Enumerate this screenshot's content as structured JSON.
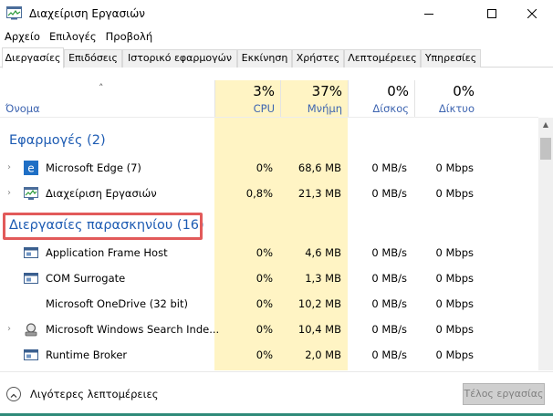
{
  "window": {
    "title": "Διαχείριση Εργασιών"
  },
  "menu": [
    "Αρχείο",
    "Επιλογές",
    "Προβολή"
  ],
  "tabs": [
    {
      "label": "Διεργασίες",
      "active": true
    },
    {
      "label": "Επιδόσεις",
      "active": false
    },
    {
      "label": "Ιστορικό εφαρμογών",
      "active": false
    },
    {
      "label": "Εκκίνηση",
      "active": false
    },
    {
      "label": "Χρήστες",
      "active": false
    },
    {
      "label": "Λεπτομέρειες",
      "active": false
    },
    {
      "label": "Υπηρεσίες",
      "active": false
    }
  ],
  "columns": {
    "name": "Όνομα",
    "cpu": {
      "percent": "3%",
      "label": "CPU"
    },
    "memory": {
      "percent": "37%",
      "label": "Μνήμη"
    },
    "disk": {
      "percent": "0%",
      "label": "Δίσκος"
    },
    "network": {
      "percent": "0%",
      "label": "Δίκτυο"
    }
  },
  "groups": {
    "apps": {
      "title": "Εφαρμογές (2)",
      "rows": [
        {
          "name": "Microsoft Edge (7)",
          "icon": "edge-icon",
          "expandable": true,
          "cpu": "0%",
          "memory": "68,6 MB",
          "disk": "0 MB/s",
          "network": "0 Mbps"
        },
        {
          "name": "Διαχείριση Εργασιών",
          "icon": "task-manager-icon",
          "expandable": true,
          "cpu": "0,8%",
          "memory": "21,3 MB",
          "disk": "0 MB/s",
          "network": "0 Mbps"
        }
      ]
    },
    "background": {
      "title": "Διεργασίες παρασκηνίου (16)",
      "rows": [
        {
          "name": "Application Frame Host",
          "icon": "app-window-icon",
          "expandable": false,
          "cpu": "0%",
          "memory": "4,6 MB",
          "disk": "0 MB/s",
          "network": "0 Mbps"
        },
        {
          "name": "COM Surrogate",
          "icon": "app-window-icon",
          "expandable": false,
          "cpu": "0%",
          "memory": "1,3 MB",
          "disk": "0 MB/s",
          "network": "0 Mbps"
        },
        {
          "name": "Microsoft OneDrive (32 bit)",
          "icon": "",
          "expandable": false,
          "cpu": "0%",
          "memory": "10,2 MB",
          "disk": "0 MB/s",
          "network": "0 Mbps"
        },
        {
          "name": "Microsoft Windows Search Inde...",
          "icon": "search-indexer-icon",
          "expandable": true,
          "cpu": "0%",
          "memory": "10,4 MB",
          "disk": "0 MB/s",
          "network": "0 Mbps"
        },
        {
          "name": "Runtime Broker",
          "icon": "app-window-icon",
          "expandable": false,
          "cpu": "0%",
          "memory": "2,0 MB",
          "disk": "0 MB/s",
          "network": "0 Mbps"
        }
      ]
    }
  },
  "footer": {
    "less_details": "Λιγότερες λεπτομέρειες",
    "end_task": "Τέλος εργασίας"
  },
  "colors": {
    "accent_blue": "#1e5cb3",
    "heat_yellow": "#fff4c4",
    "highlight_red": "#e25a5a"
  }
}
